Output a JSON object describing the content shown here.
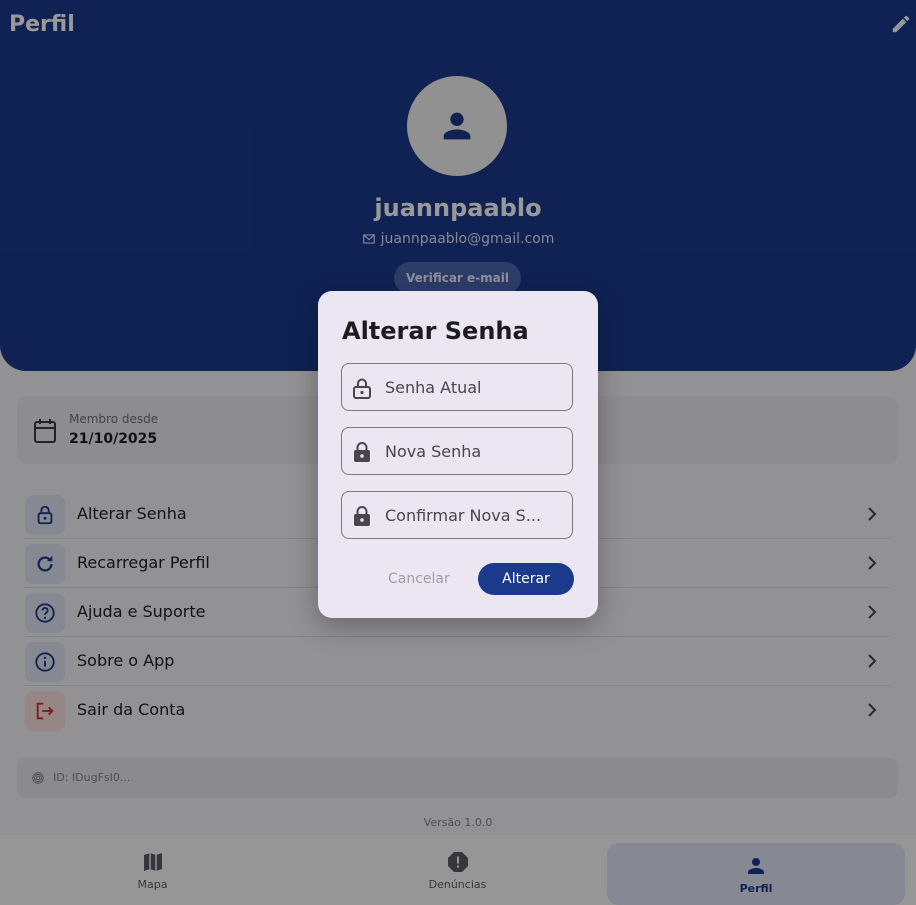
{
  "header": {
    "title": "Perfil",
    "edit_icon": "pencil-icon"
  },
  "profile": {
    "avatar_icon": "person-icon",
    "username": "juannpaablo",
    "email": "juannpaablo@gmail.com",
    "verify_label": "Verificar e-mail"
  },
  "member": {
    "label": "Membro desde",
    "date": "21/10/2025"
  },
  "menu": {
    "items": [
      {
        "label": "Alterar Senha",
        "icon": "lock-icon"
      },
      {
        "label": "Recarregar Perfil",
        "icon": "refresh-icon"
      },
      {
        "label": "Ajuda e Suporte",
        "icon": "help-icon"
      },
      {
        "label": "Sobre o App",
        "icon": "info-icon"
      },
      {
        "label": "Sair da Conta",
        "icon": "logout-icon"
      }
    ]
  },
  "account": {
    "id_text": "ID: IDugFsI0..."
  },
  "version": "Versão 1.0.0",
  "nav": {
    "items": [
      {
        "label": "Mapa",
        "icon": "map-icon"
      },
      {
        "label": "Denúncias",
        "icon": "alert-icon"
      },
      {
        "label": "Perfil",
        "icon": "person-icon"
      }
    ]
  },
  "dialog": {
    "title": "Alterar Senha",
    "current_password_placeholder": "Senha Atual",
    "new_password_placeholder": "Nova Senha",
    "confirm_password_placeholder": "Confirmar Nova S...",
    "cancel_label": "Cancelar",
    "confirm_label": "Alterar"
  },
  "colors": {
    "primary": "#1b3a8c",
    "danger": "#d32f2f",
    "background": "#f4f2f7"
  }
}
